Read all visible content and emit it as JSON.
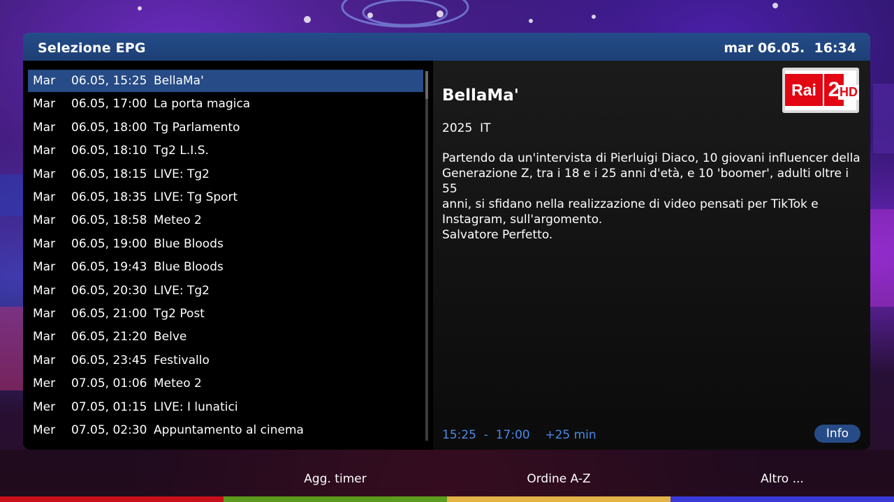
{
  "header": {
    "title": "Selezione EPG",
    "datetime": "mar 06.05.  16:34"
  },
  "events": [
    {
      "day": "Mar",
      "date": "06.05, 15:25",
      "title": "BellaMa'"
    },
    {
      "day": "Mar",
      "date": "06.05, 17:00",
      "title": "La porta magica"
    },
    {
      "day": "Mar",
      "date": "06.05, 18:00",
      "title": "Tg Parlamento"
    },
    {
      "day": "Mar",
      "date": "06.05, 18:10",
      "title": "Tg2 L.I.S."
    },
    {
      "day": "Mar",
      "date": "06.05, 18:15",
      "title": "LIVE: Tg2"
    },
    {
      "day": "Mar",
      "date": "06.05, 18:35",
      "title": "LIVE: Tg Sport"
    },
    {
      "day": "Mar",
      "date": "06.05, 18:58",
      "title": "Meteo 2"
    },
    {
      "day": "Mar",
      "date": "06.05, 19:00",
      "title": "Blue Bloods"
    },
    {
      "day": "Mar",
      "date": "06.05, 19:43",
      "title": "Blue Bloods"
    },
    {
      "day": "Mar",
      "date": "06.05, 20:30",
      "title": "LIVE: Tg2"
    },
    {
      "day": "Mar",
      "date": "06.05, 21:00",
      "title": "Tg2 Post"
    },
    {
      "day": "Mar",
      "date": "06.05, 21:20",
      "title": "Belve"
    },
    {
      "day": "Mar",
      "date": "06.05, 23:45",
      "title": "Festivallo"
    },
    {
      "day": "Mer",
      "date": "07.05, 01:06",
      "title": "Meteo 2"
    },
    {
      "day": "Mer",
      "date": "07.05, 01:15",
      "title": "LIVE: I lunatici"
    },
    {
      "day": "Mer",
      "date": "07.05, 02:30",
      "title": "Appuntamento al cinema"
    }
  ],
  "selected_index": 0,
  "detail": {
    "title": "BellaMa'",
    "meta": "2025  IT",
    "description": "Partendo da un'intervista di Pierluigi Diaco, 10 giovani influencer della\nGenerazione Z, tra i 18 e i 25 anni d'età, e 10 'boomer', adulti oltre i 55\nanni, si sfidano nella realizzazione di video pensati per TikTok e\nInstagram, sull'argomento.\nSalvatore Perfetto.",
    "times": "15:25  -  17:00    +25 min",
    "info_button": "Info",
    "channel_logo": {
      "rai": "Rai",
      "number": "2",
      "hd": "HD"
    }
  },
  "footer": {
    "red": "",
    "green": "Agg. timer",
    "yellow": "Ordine A-Z",
    "blue": "Altro ..."
  },
  "colors": {
    "header_bg": "#244c89",
    "selection": "#264b86",
    "time_blue": "#4a8ae8",
    "red": "#c8101a",
    "green": "#5c9b1d",
    "yellow": "#e3b347",
    "blue": "#3a3ad6"
  }
}
